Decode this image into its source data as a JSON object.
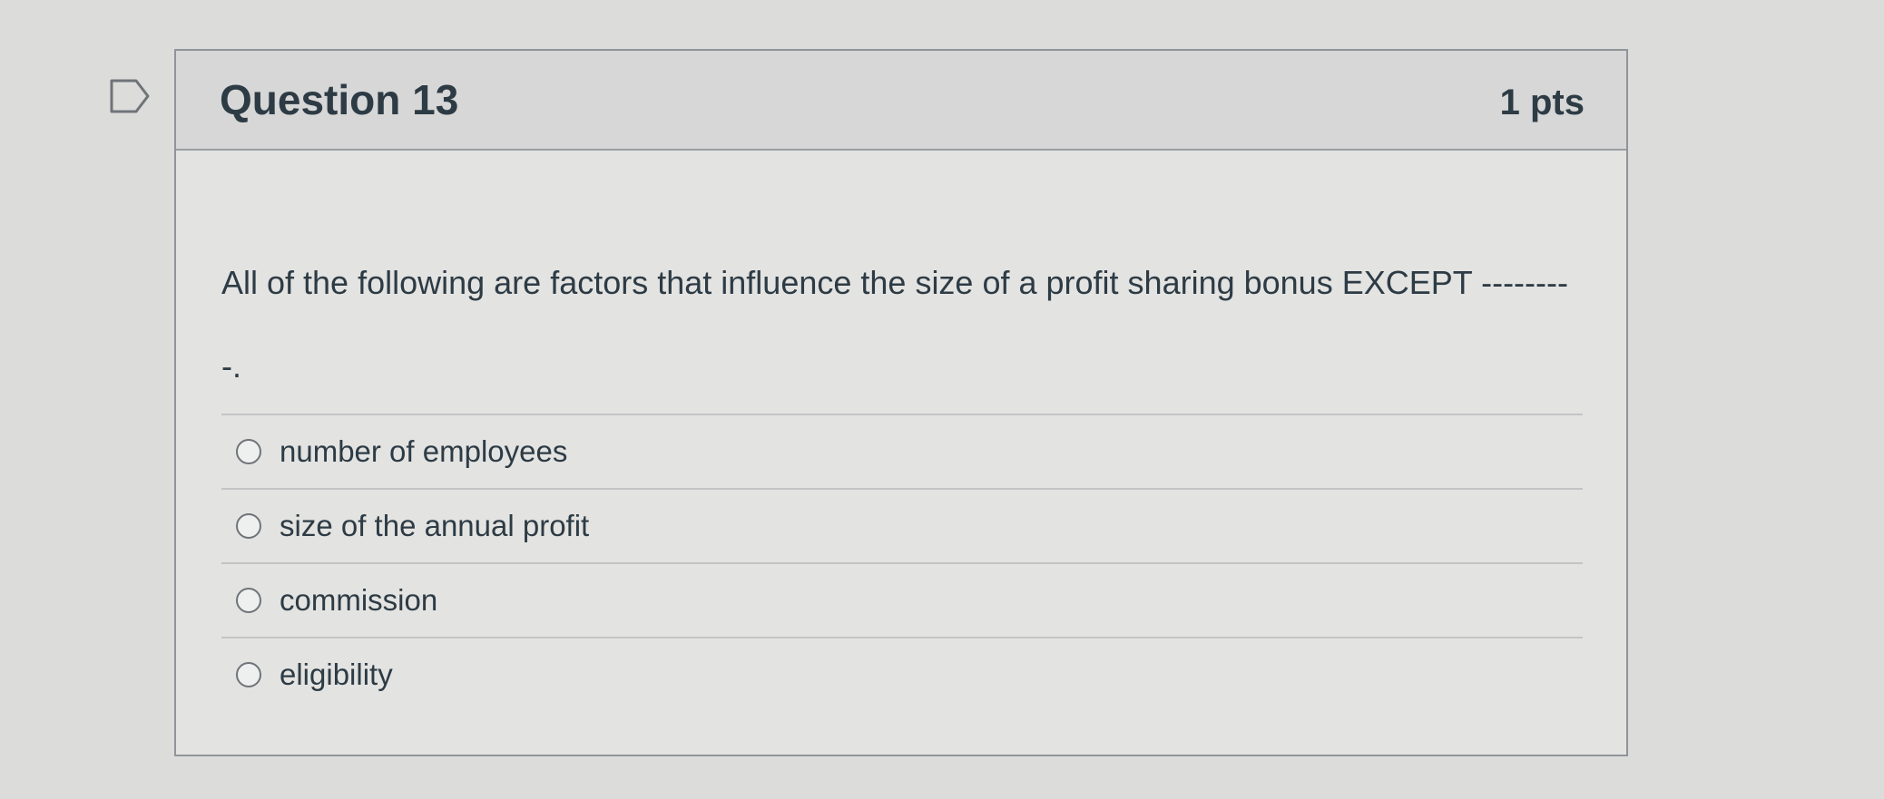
{
  "question": {
    "title": "Question 13",
    "points": "1 pts",
    "text": "All of the following are factors that influence the size of a profit sharing bonus EXCEPT ---------."
  },
  "answers": [
    {
      "label": "number of employees"
    },
    {
      "label": "size of the annual profit"
    },
    {
      "label": "commission"
    },
    {
      "label": "eligibility"
    }
  ],
  "icons": {
    "flag": "bookmark-flag-icon"
  },
  "colors": {
    "text": "#2d3b45",
    "header_bg": "#d6d7d6",
    "card_bg": "#e3e3e1",
    "border": "#8f9499"
  }
}
